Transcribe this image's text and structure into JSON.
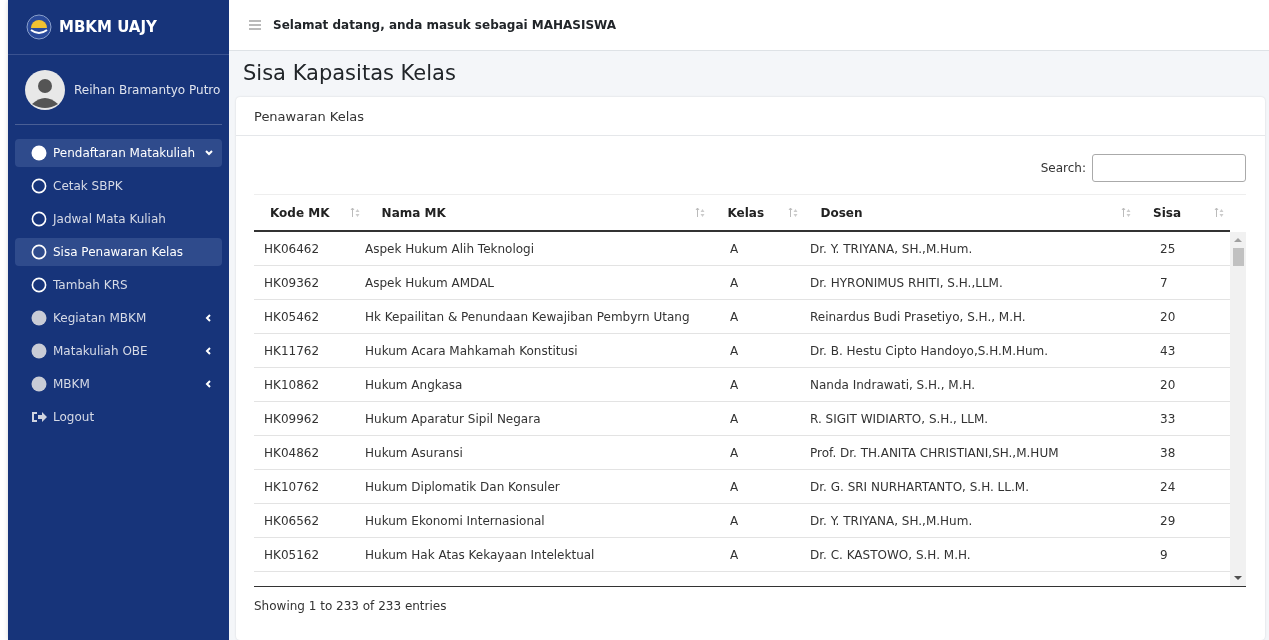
{
  "brand": {
    "name": "MBKM UAJY"
  },
  "user": {
    "name": "Reihan Bramantyo Putro"
  },
  "sidebar": {
    "items": [
      {
        "label": "Pendaftaran Matakuliah",
        "kind": "group",
        "selected": true,
        "expanded": true
      },
      {
        "label": "Cetak SBPK",
        "kind": "sub",
        "selected": false
      },
      {
        "label": "Jadwal Mata Kuliah",
        "kind": "sub",
        "selected": false
      },
      {
        "label": "Sisa Penawaran Kelas",
        "kind": "sub",
        "selected": true
      },
      {
        "label": "Tambah KRS",
        "kind": "sub",
        "selected": false
      },
      {
        "label": "Kegiatan MBKM",
        "kind": "group",
        "selected": false,
        "expanded": false
      },
      {
        "label": "Matakuliah OBE",
        "kind": "group",
        "selected": false,
        "expanded": false
      },
      {
        "label": "MBKM",
        "kind": "group",
        "selected": false,
        "expanded": false
      },
      {
        "label": "Logout",
        "kind": "logout",
        "selected": false
      }
    ]
  },
  "topbar": {
    "welcome": "Selamat datang, anda masuk sebagai MAHASISWA"
  },
  "page_title": "Sisa Kapasitas Kelas",
  "card": {
    "title": "Penawaran Kelas",
    "search_label": "Search:",
    "table": {
      "columns": [
        "Kode MK",
        "Nama MK",
        "Kelas",
        "Dosen",
        "Sisa"
      ],
      "rows": [
        [
          "HK06462",
          "Aspek Hukum Alih Teknologi",
          "A",
          "Dr. Y. TRIYANA, SH.,M.Hum.",
          "25"
        ],
        [
          "HK09362",
          "Aspek Hukum AMDAL",
          "A",
          "Dr. HYRONIMUS RHITI, S.H.,LLM.",
          "7"
        ],
        [
          "HK05462",
          "Hk Kepailitan & Penundaan Kewajiban Pembyrn Utang",
          "A",
          "Reinardus Budi Prasetiyo, S.H., M.H.",
          "20"
        ],
        [
          "HK11762",
          "Hukum Acara Mahkamah Konstitusi",
          "A",
          "Dr. B. Hestu Cipto Handoyo,S.H.M.Hum.",
          "43"
        ],
        [
          "HK10862",
          "Hukum Angkasa",
          "A",
          "Nanda Indrawati, S.H., M.H.",
          "20"
        ],
        [
          "HK09962",
          "Hukum Aparatur Sipil Negara",
          "A",
          "R. SIGIT WIDIARTO, S.H., LLM.",
          "33"
        ],
        [
          "HK04862",
          "Hukum Asuransi",
          "A",
          "Prof. Dr. TH.ANITA CHRISTIANI,SH.,M.HUM",
          "38"
        ],
        [
          "HK10762",
          "Hukum Diplomatik Dan Konsuler",
          "A",
          "Dr. G. SRI NURHARTANTO, S.H. LL.M.",
          "24"
        ],
        [
          "HK06562",
          "Hukum Ekonomi Internasional",
          "A",
          "Dr. Y. TRIYANA, SH.,M.Hum.",
          "29"
        ],
        [
          "HK05162",
          "Hukum Hak Atas Kekayaan Intelektual",
          "A",
          "Dr. C. KASTOWO, S.H. M.H.",
          "9"
        ]
      ]
    },
    "info": "Showing 1 to 233 of 233 entries"
  }
}
